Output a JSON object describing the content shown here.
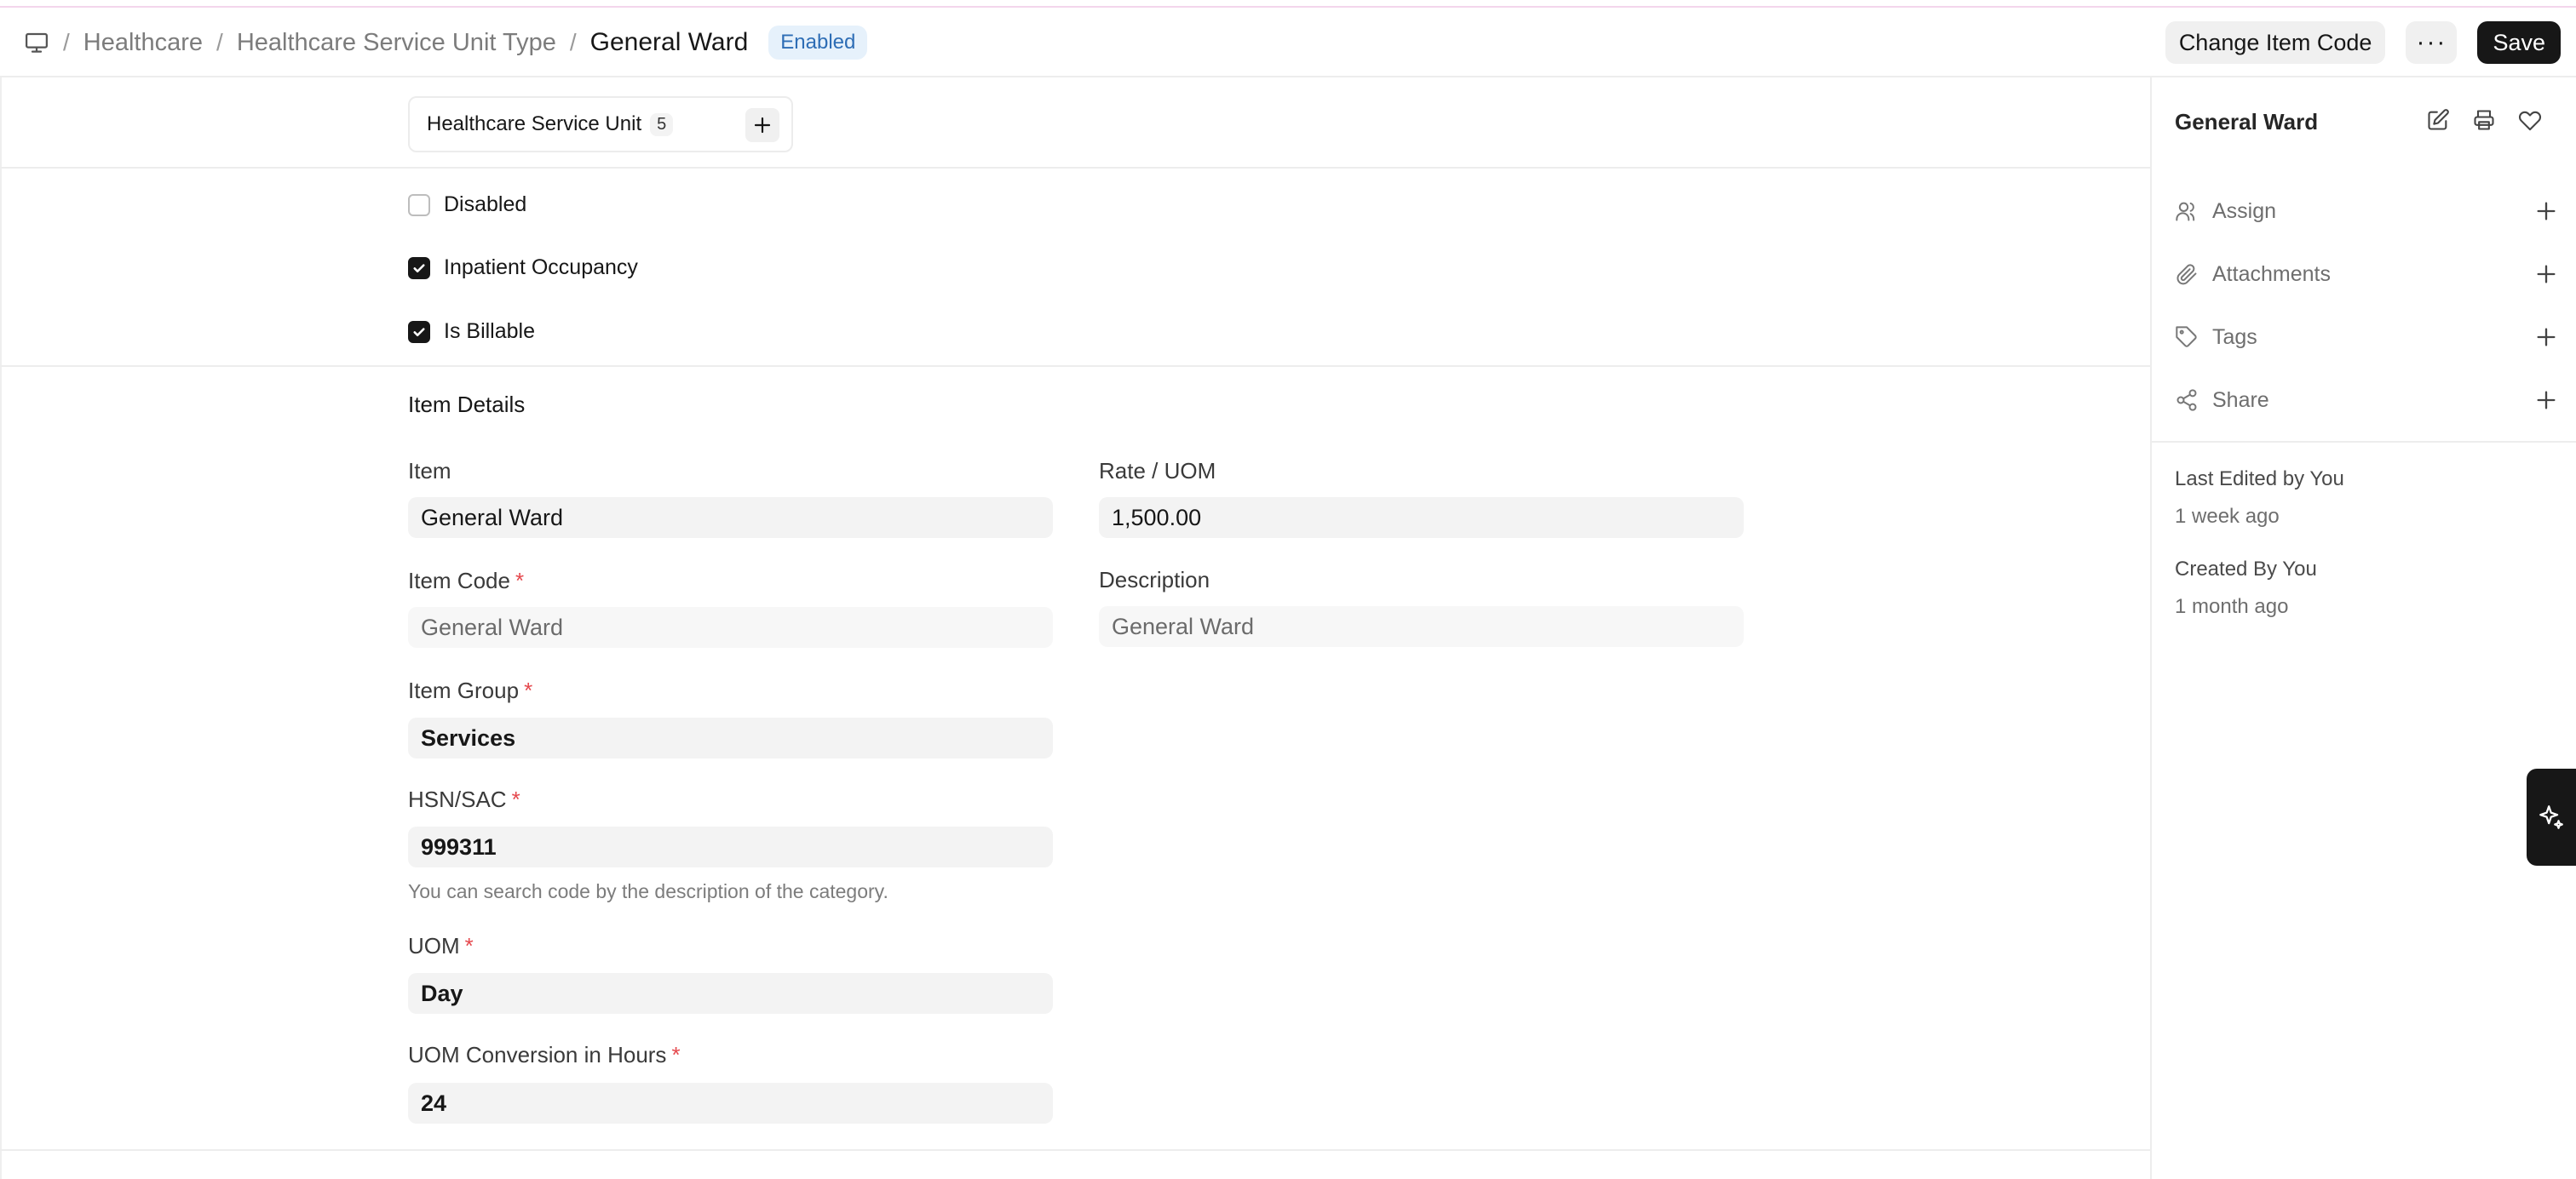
{
  "breadcrumb": {
    "icon": "desktop-icon",
    "items": [
      "Healthcare",
      "Healthcare Service Unit Type"
    ],
    "current": "General Ward",
    "status_badge": "Enabled"
  },
  "toolbar": {
    "change_item_code_label": "Change Item Code",
    "more_label": "···",
    "save_label": "Save"
  },
  "connections": {
    "label": "Healthcare Service Unit",
    "count": "5"
  },
  "checkboxes": [
    {
      "label": "Disabled",
      "checked": false
    },
    {
      "label": "Inpatient Occupancy",
      "checked": true
    },
    {
      "label": "Is Billable",
      "checked": true
    }
  ],
  "item_details": {
    "section_title": "Item Details",
    "item": {
      "label": "Item",
      "value": "General Ward"
    },
    "rate_uom": {
      "label": "Rate / UOM",
      "value": "1,500.00"
    },
    "item_code": {
      "label": "Item Code",
      "required": "*",
      "value": "General Ward"
    },
    "description": {
      "label": "Description",
      "value": "General Ward"
    },
    "item_group": {
      "label": "Item Group",
      "required": "*",
      "value": "Services"
    },
    "hsn_sac": {
      "label": "HSN/SAC",
      "required": "*",
      "value": "999311",
      "help": "You can search code by the description of the category."
    },
    "uom": {
      "label": "UOM",
      "required": "*",
      "value": "Day"
    },
    "uom_conversion": {
      "label": "UOM Conversion in Hours",
      "required": "*",
      "value": "24"
    }
  },
  "sidebar": {
    "title": "General Ward",
    "actions": [
      {
        "label": "Assign",
        "icon": "users-icon"
      },
      {
        "label": "Attachments",
        "icon": "paperclip-icon"
      },
      {
        "label": "Tags",
        "icon": "tag-icon"
      },
      {
        "label": "Share",
        "icon": "share-icon"
      }
    ],
    "last_edited": "Last Edited by You",
    "last_edited_time": "1 week ago",
    "created_by": "Created By You",
    "created_time": "1 month ago"
  },
  "colors": {
    "accent_dark": "#171717",
    "badge_bg": "#e6f1fb",
    "badge_text": "#2d6db5",
    "required": "#e5484d"
  }
}
